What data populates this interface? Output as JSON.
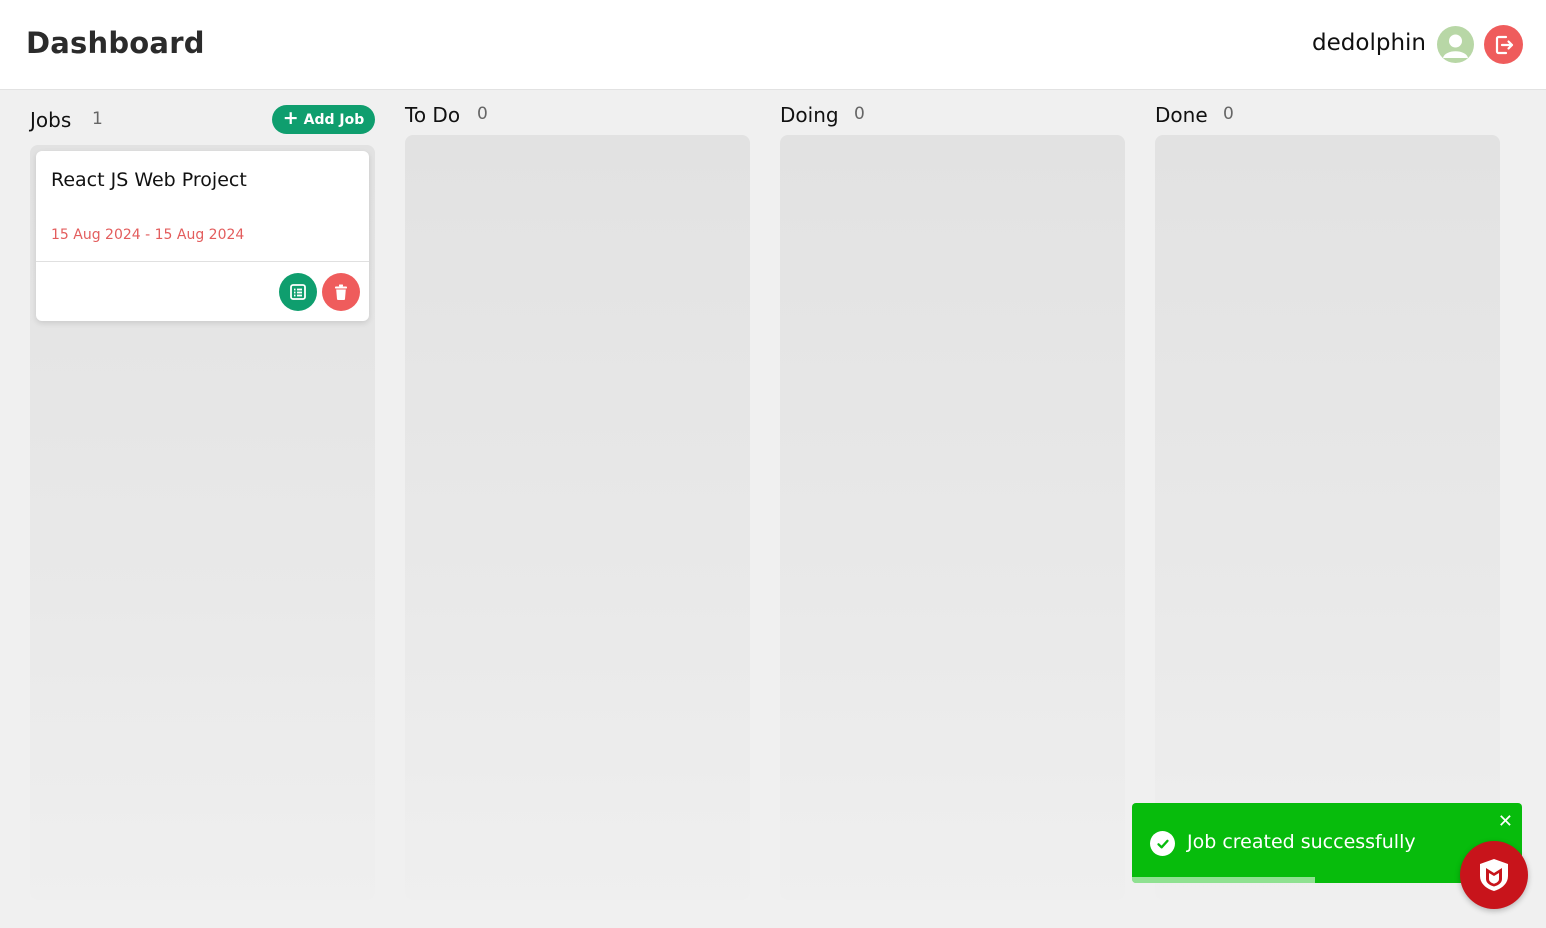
{
  "header": {
    "title": "Dashboard",
    "username": "dedolphin",
    "avatar_icon": "user-avatar-icon",
    "logout_icon": "logout-icon"
  },
  "columns": [
    {
      "title": "Jobs",
      "count": "1"
    },
    {
      "title": "To Do",
      "count": "0"
    },
    {
      "title": "Doing",
      "count": "0"
    },
    {
      "title": "Done",
      "count": "0"
    }
  ],
  "jobs": {
    "add_label": "Add Job",
    "cards": [
      {
        "title": "React JS Web Project",
        "dates": "15 Aug 2024 - 15 Aug 2024",
        "details_icon": "list-icon",
        "delete_icon": "trash-icon"
      }
    ]
  },
  "toast": {
    "message": "Job created successfully",
    "close": "✕",
    "progress": 0.47
  },
  "colors": {
    "primary": "#0f9e6e",
    "danger": "#ef5c5c",
    "success": "#07bc0c",
    "avatar": "#b8d7a6",
    "badge": "#c8141b"
  }
}
